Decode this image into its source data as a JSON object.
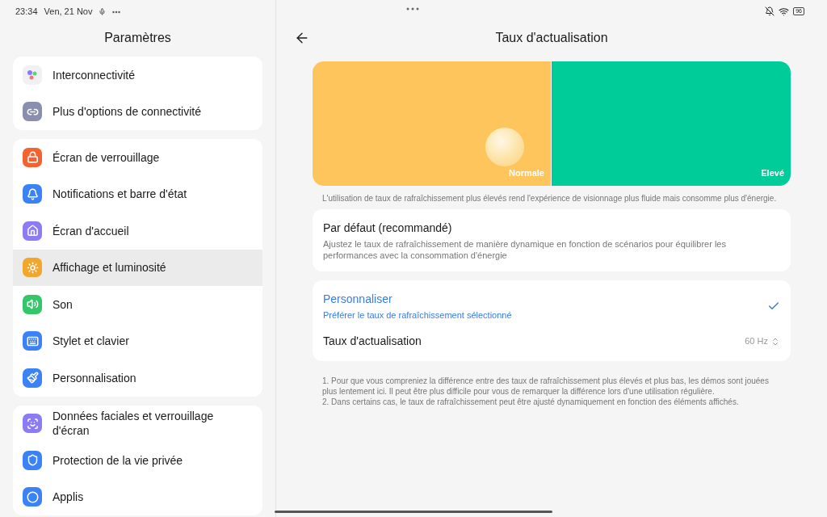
{
  "status_bar": {
    "time": "23:34",
    "date": "Ven, 21 Nov",
    "battery": "96"
  },
  "sidebar": {
    "title": "Paramètres",
    "groups": [
      {
        "items": [
          {
            "label": "Interconnectivité",
            "selected": false,
            "color": "#f1f1f4"
          },
          {
            "label": "Plus d'options de connectivité",
            "selected": false,
            "color": "#8a8fb0"
          }
        ]
      },
      {
        "items": [
          {
            "label": "Écran de verrouillage",
            "selected": false,
            "color": "#f4622f"
          },
          {
            "label": "Notifications et barre d'état",
            "selected": false,
            "color": "#3b82f6"
          },
          {
            "label": "Écran d'accueil",
            "selected": false,
            "color": "#8b7cf6"
          },
          {
            "label": "Affichage et luminosité",
            "selected": true,
            "color": "#f2a72c"
          },
          {
            "label": "Son",
            "selected": false,
            "color": "#34c76a"
          },
          {
            "label": "Stylet et clavier",
            "selected": false,
            "color": "#3b82f6"
          },
          {
            "label": "Personnalisation",
            "selected": false,
            "color": "#3b82f6"
          }
        ]
      },
      {
        "items": [
          {
            "label": "Données faciales et verrouillage d'écran",
            "selected": false,
            "color": "#8b7cf6"
          },
          {
            "label": "Protection de la vie privée",
            "selected": false,
            "color": "#3b82f6"
          },
          {
            "label": "Applis",
            "selected": false,
            "color": "#3b82f6"
          }
        ]
      }
    ]
  },
  "page": {
    "title": "Taux d'actualisation",
    "preview": {
      "left_label": "Normale",
      "right_label": "Elevé"
    },
    "note": "L'utilisation de taux de rafraîchissement plus élevés rend l'expérience de visionnage plus fluide mais consomme plus d'énergie.",
    "options": [
      {
        "title": "Par défaut (recommandé)",
        "subtitle": "Ajustez le taux de rafraîchissement de manière dynamique en fonction de scénarios pour équilibrer les performances avec la consommation d'énergie",
        "selected": false
      },
      {
        "title": "Personnaliser",
        "subtitle": "Préférer le taux de rafraîchissement sélectionné",
        "selected": true,
        "setting": {
          "label": "Taux d'actualisation",
          "value": "60 Hz"
        }
      }
    ],
    "footnotes": [
      "1. Pour que vous compreniez la différence entre des taux de rafraîchissement plus élevés et plus bas, les démos sont jouées plus lentement ici. Il peut être plus difficile pour vous de remarquer la différence lors d'une utilisation régulière.",
      "2. Dans certains cas, le taux de rafraîchissement peut être ajusté dynamiquement en fonction des éléments affichés."
    ]
  }
}
